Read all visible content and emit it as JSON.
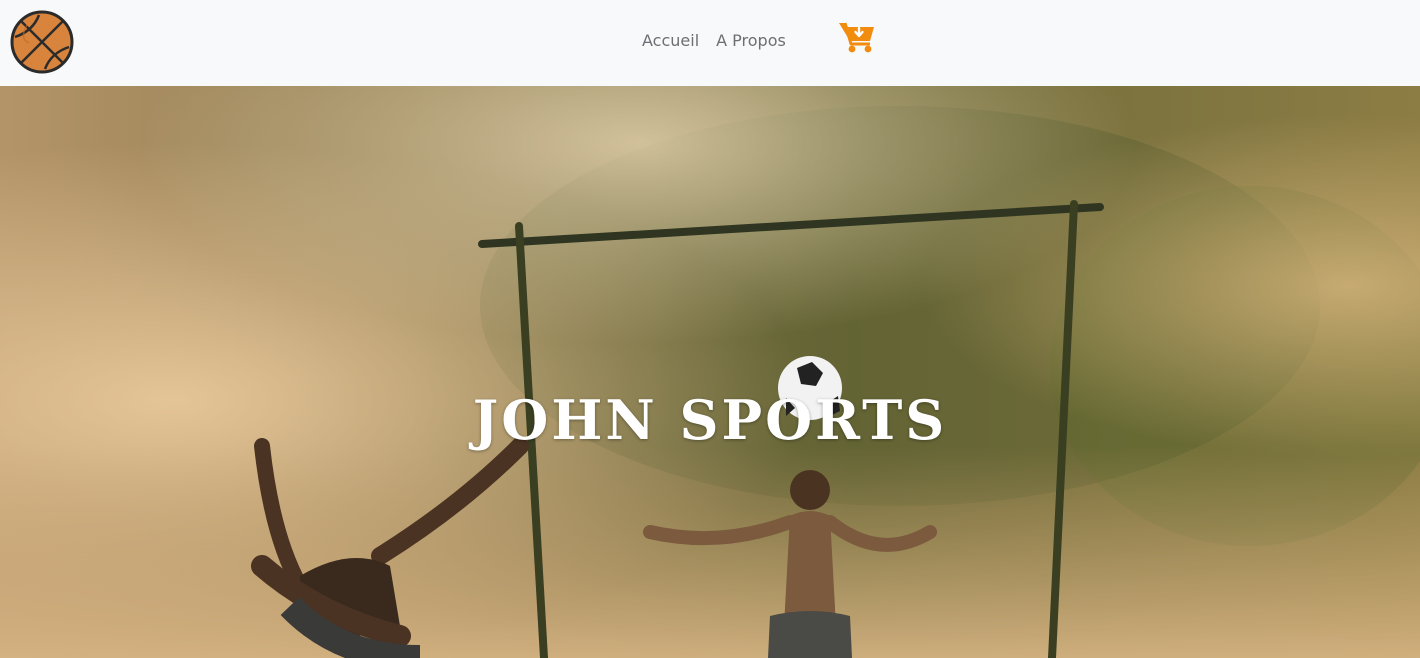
{
  "nav": {
    "logo_icon": "basketball-icon",
    "links": [
      {
        "label": "Accueil"
      },
      {
        "label": "A Propos"
      }
    ],
    "cart_icon": "cart-download-icon",
    "cart_color": "#f28c0f",
    "text_color": "#6c6f73",
    "background": "#f8f9fa"
  },
  "hero": {
    "title": "JOHN SPORTS",
    "image_subject": "hero-photo"
  }
}
